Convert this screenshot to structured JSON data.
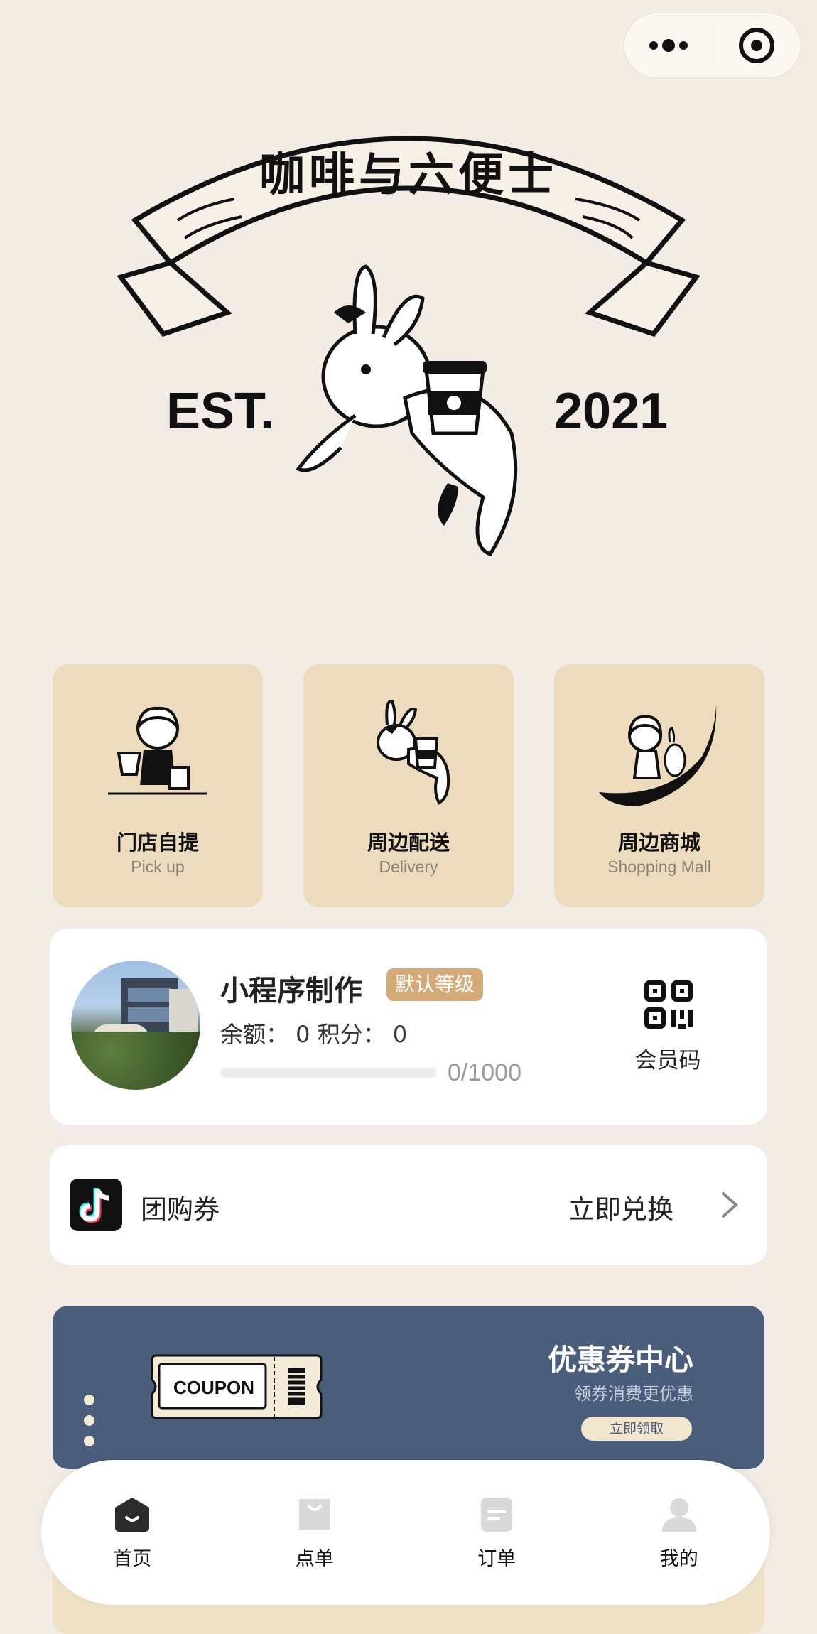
{
  "capsule": {
    "more_icon": "more-dots-icon",
    "close_icon": "target-icon"
  },
  "logo": {
    "title": "咖啡与六便士",
    "est": "EST.",
    "year": "2021"
  },
  "services": [
    {
      "title": "门店自提",
      "subtitle": "Pick up"
    },
    {
      "title": "周边配送",
      "subtitle": "Delivery"
    },
    {
      "title": "周边商城",
      "subtitle": "Shopping Mall"
    }
  ],
  "member": {
    "name": "小程序制作",
    "level": "默认等级",
    "balance_text": "余额： 0   积分： 0",
    "progress_text": "0/1000",
    "progress_value": 0,
    "qr_label": "会员码"
  },
  "groupbuy": {
    "label": "团购券",
    "action": "立即兑换"
  },
  "coupon": {
    "ticket_text": "COUPON",
    "title": "优惠券中心",
    "subtitle": "领券消费更优惠",
    "button": "立即领取"
  },
  "tabbar": [
    {
      "label": "首页",
      "icon": "home-icon",
      "active": true
    },
    {
      "label": "点单",
      "icon": "bag-icon",
      "active": false
    },
    {
      "label": "订单",
      "icon": "order-icon",
      "active": false
    },
    {
      "label": "我的",
      "icon": "profile-icon",
      "active": false
    }
  ],
  "colors": {
    "background": "#f3ece4",
    "card": "#ecdcbd",
    "accent": "#d3aa78",
    "banner": "#4a5e7c"
  }
}
